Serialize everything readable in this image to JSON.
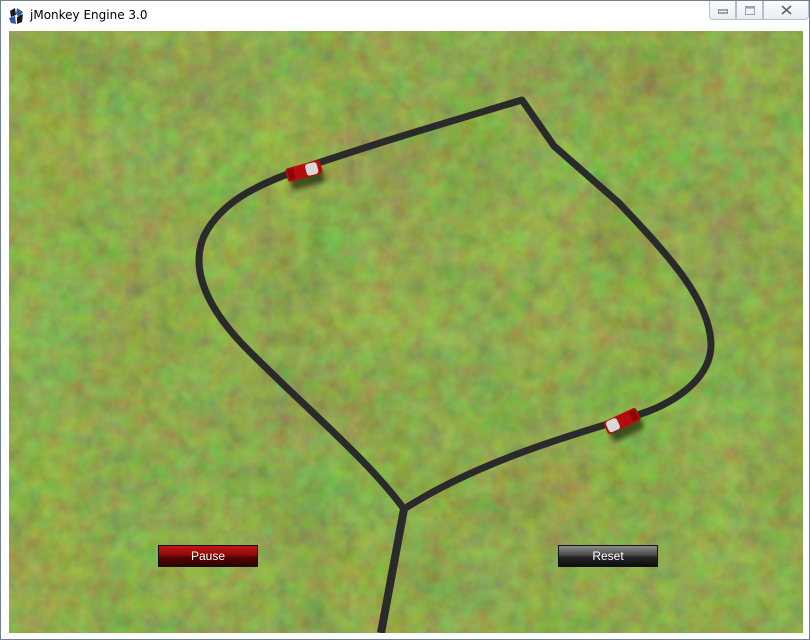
{
  "window": {
    "title": "jMonkey Engine 3.0",
    "controls": {
      "minimize": "minimize-icon",
      "maximize": "maximize-icon",
      "close": "close-icon"
    }
  },
  "scene": {
    "ground": "grass-terrain",
    "track_color": "#2a2a2a",
    "car_color": "#b30d0d",
    "car_count": 2
  },
  "hud": {
    "pause_label": "Pause",
    "reset_label": "Reset",
    "pause_color": "#8a0a0a",
    "reset_color": "#3a3a3a"
  }
}
